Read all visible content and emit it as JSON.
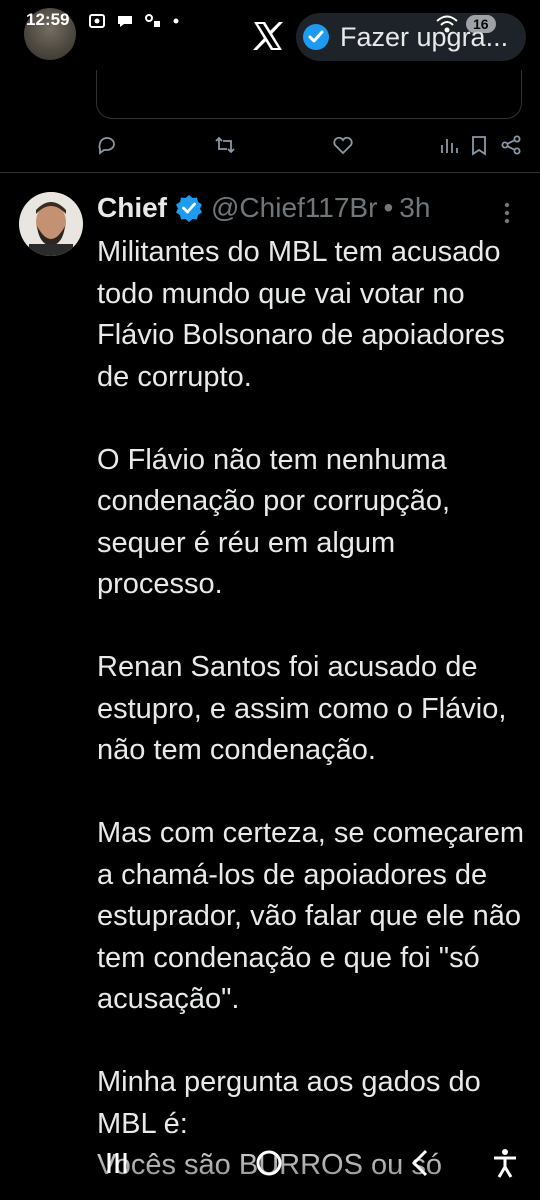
{
  "status_bar": {
    "time": "12:59",
    "battery": "16"
  },
  "header": {
    "upgrade_label": "Fazer upgra..."
  },
  "tweet": {
    "author_name": "Chief",
    "handle": "@Chief117Br",
    "separator": "•",
    "time": "3h",
    "text": "Militantes do MBL tem acusado todo mundo que vai votar no Flávio Bolsonaro de apoiadores de corrupto.\n\nO Flávio não tem nenhuma condenação por corrupção, sequer é réu em algum processo.\n\nRenan Santos foi acusado de estupro, e assim como o Flávio, não tem condenação.\n\nMas com certeza, se começarem a chamá-los de apoiadores de estuprador, vão falar que ele não tem condenação e que foi \"só acusação\".\n\nMinha pergunta aos gados do MBL é:\nVocês são BURROS ou só"
  },
  "icons": {
    "reply": "reply-icon",
    "retweet": "retweet-icon",
    "like": "heart-icon",
    "views": "views-icon",
    "bookmark": "bookmark-icon",
    "share": "share-icon",
    "verified": "verified-badge-icon",
    "more": "more-vertical-icon",
    "nav_recent": "recent-apps-icon",
    "nav_home": "home-circle-icon",
    "nav_back": "back-chevron-icon",
    "nav_accessibility": "accessibility-icon"
  },
  "colors": {
    "background": "#000000",
    "text": "#e7e9ea",
    "muted": "#71767b",
    "verified_blue": "#1d9bf0",
    "pill_bg": "#1d2329"
  }
}
